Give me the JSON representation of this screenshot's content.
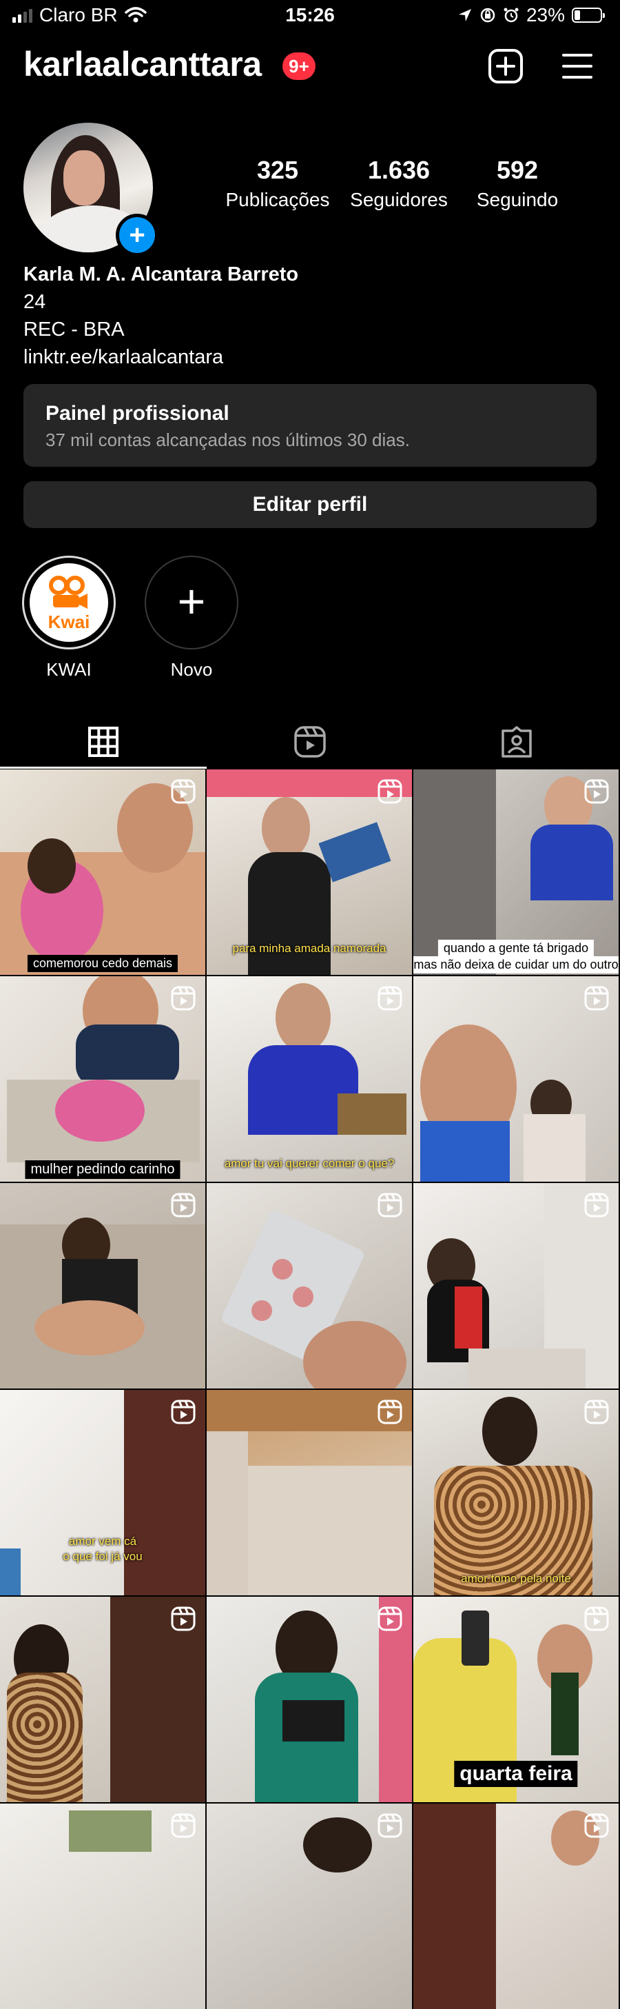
{
  "status_bar": {
    "carrier": "Claro BR",
    "time": "15:26",
    "battery": "23%"
  },
  "header": {
    "username": "karlaalcanttara",
    "notification_badge": "9+"
  },
  "profile": {
    "stats": [
      {
        "value": "325",
        "label": "Publicações"
      },
      {
        "value": "1.636",
        "label": "Seguidores"
      },
      {
        "value": "592",
        "label": "Seguindo"
      }
    ],
    "name": "Karla M. A. Alcantara Barreto",
    "bio_lines": [
      "24",
      "REC - BRA",
      "linktr.ee/karlaalcantara"
    ]
  },
  "dashboard": {
    "title": "Painel profissional",
    "subtitle": "37 mil contas alcançadas nos últimos 30 dias."
  },
  "edit_button": "Editar perfil",
  "highlights": [
    {
      "label": "KWAI",
      "logo_text": "Kwai"
    },
    {
      "label": "Novo"
    }
  ],
  "grid_captions": {
    "r1c1": "comemorou cedo demais",
    "r1c2": "para minha amada namorada",
    "r1c3_l1": "quando a gente tá brigado",
    "r1c3_l2": "mas não deixa de cuidar um do outro",
    "r2c1": "mulher pedindo carinho",
    "r2c2": "amor tu vai querer comer o que?",
    "r4c1_l1": "amor vem cá",
    "r4c1_l2": "o que foi já vou",
    "r4c3": "amor tomo pela noite",
    "r5c3": "quarta feira"
  },
  "colors": {
    "accent_blue": "#0095f6",
    "badge_red": "#ff3040",
    "panel_bg": "#262626",
    "kwai_orange": "#ff7a00"
  }
}
